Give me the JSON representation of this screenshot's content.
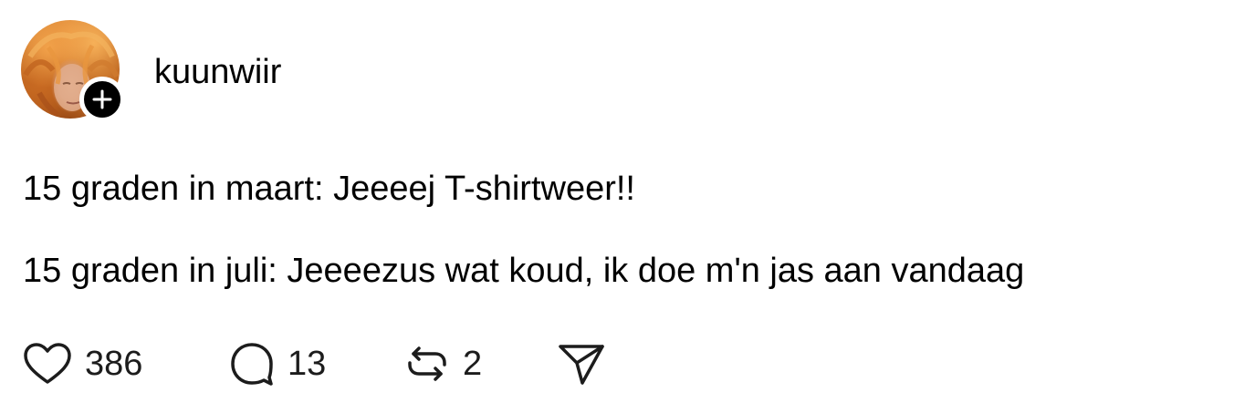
{
  "post": {
    "author": {
      "username": "kuunwiir",
      "avatar_icon": "profile-photo",
      "follow_icon": "plus-icon"
    },
    "lines": [
      "15 graden in maart: Jeeeej T-shirtweer!!",
      "15 graden in juli: Jeeeezus wat koud, ik doe m'n jas aan vandaag"
    ],
    "actions": {
      "likes": {
        "icon": "heart-icon",
        "count": "386"
      },
      "comments": {
        "icon": "comment-icon",
        "count": "13"
      },
      "reposts": {
        "icon": "repost-icon",
        "count": "2"
      },
      "share": {
        "icon": "send-icon"
      }
    }
  }
}
